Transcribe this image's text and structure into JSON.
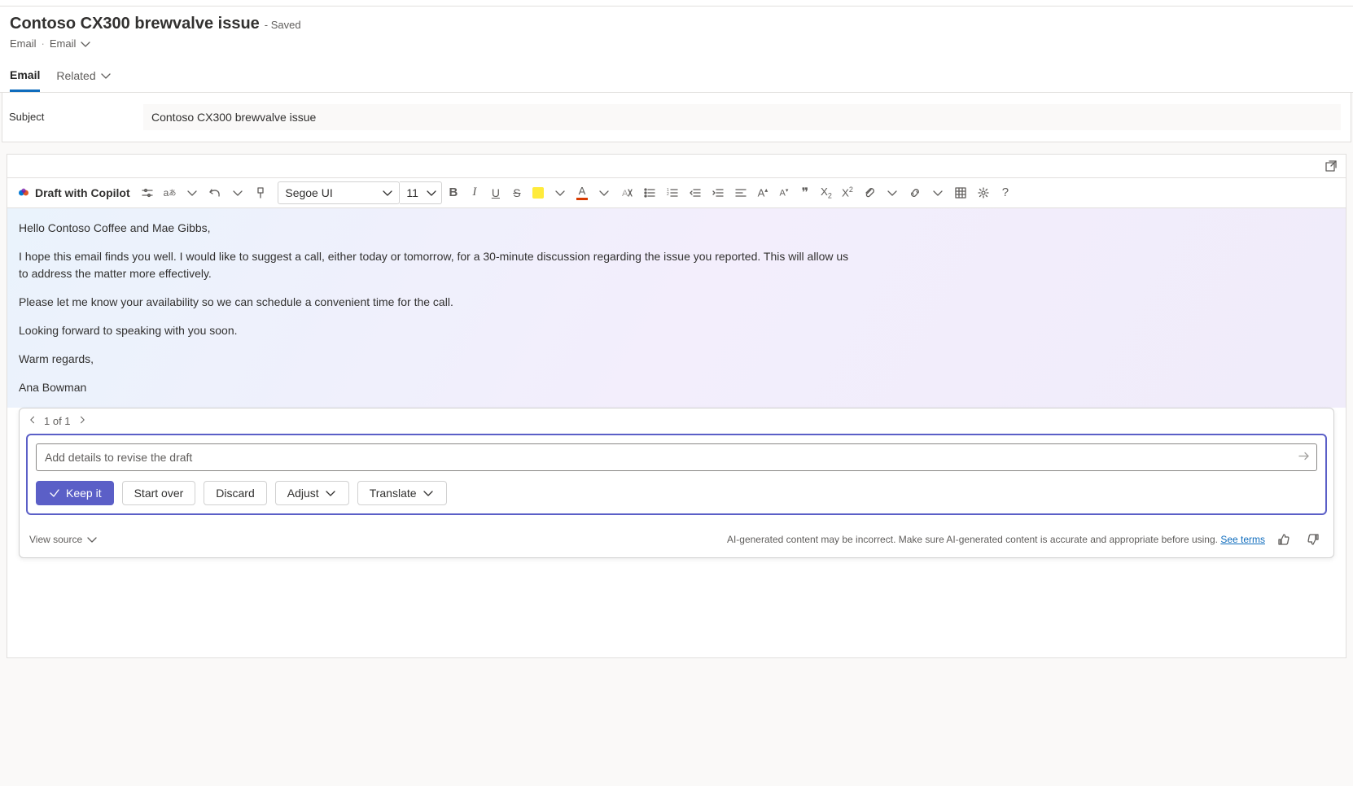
{
  "header": {
    "title": "Contoso CX300 brewvalve issue",
    "status": "- Saved",
    "breadcrumb1": "Email",
    "breadcrumb2": "Email"
  },
  "tabs": {
    "email": "Email",
    "related": "Related"
  },
  "subject": {
    "label": "Subject",
    "value": "Contoso CX300 brewvalve issue"
  },
  "toolbar": {
    "draft_label": "Draft with Copilot",
    "font": "Segoe UI",
    "size": "11"
  },
  "email_body": {
    "p1": "Hello Contoso Coffee and Mae Gibbs,",
    "p2": "I hope this email finds you well. I would like to suggest a call, either today or tomorrow, for a 30-minute discussion regarding the issue you reported. This will allow us to address the matter more effectively.",
    "p3": "Please let me know your availability so we can schedule a convenient time for the call.",
    "p4": "Looking forward to speaking with you soon.",
    "p5": "Warm regards,",
    "p6": "Ana Bowman"
  },
  "copilot": {
    "pager": "1 of 1",
    "revise_placeholder": "Add details to revise the draft",
    "keep": "Keep it",
    "start_over": "Start over",
    "discard": "Discard",
    "adjust": "Adjust",
    "translate": "Translate",
    "view_source": "View source",
    "disclaimer": "AI-generated content may be incorrect. Make sure AI-generated content is accurate and appropriate before using. ",
    "see_terms": "See terms"
  }
}
